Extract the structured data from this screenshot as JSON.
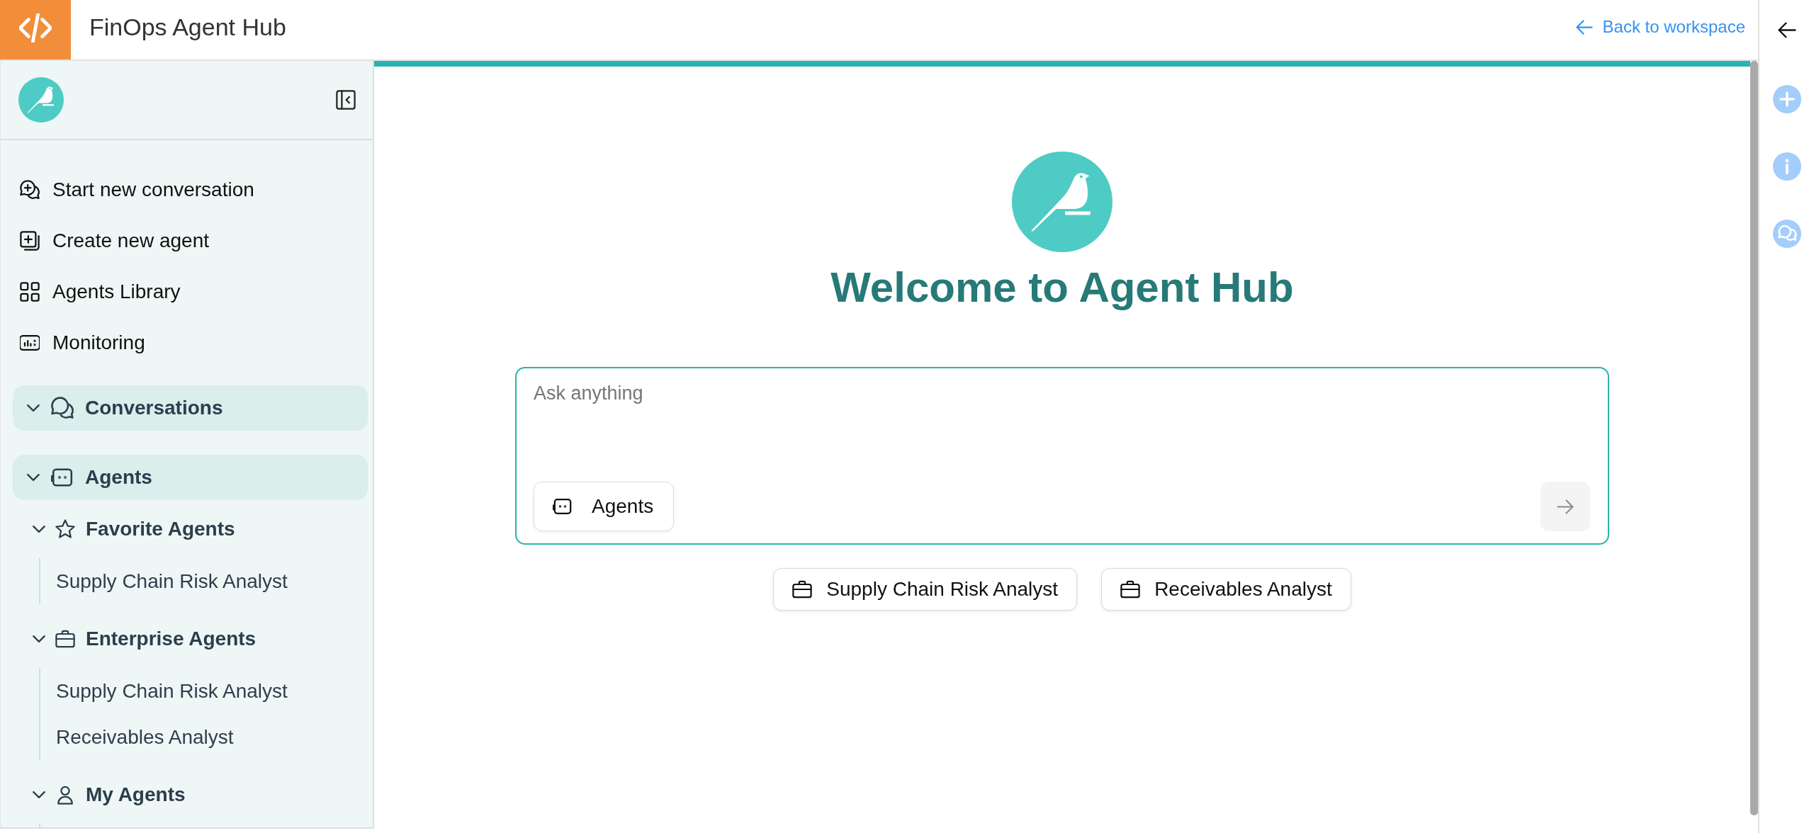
{
  "header": {
    "title": "FinOps Agent Hub",
    "back_link": "Back to workspace"
  },
  "sidebar": {
    "actions": [
      {
        "label": "Start new conversation",
        "kind": "chat-plus"
      },
      {
        "label": "Create new agent",
        "kind": "square-plus"
      },
      {
        "label": "Agents Library",
        "kind": "grid"
      },
      {
        "label": "Monitoring",
        "kind": "monitor"
      }
    ],
    "sections": [
      {
        "label": "Conversations",
        "kind": "chats",
        "expanded": true
      },
      {
        "label": "Agents",
        "kind": "robot",
        "expanded": true,
        "children": [
          {
            "label": "Favorite Agents",
            "kind": "star",
            "expanded": true,
            "children": [
              {
                "label": "Supply Chain Risk Analyst"
              }
            ]
          },
          {
            "label": "Enterprise Agents",
            "kind": "briefcase",
            "expanded": true,
            "children": [
              {
                "label": "Supply Chain Risk Analyst"
              },
              {
                "label": "Receivables Analyst"
              }
            ]
          },
          {
            "label": "My Agents",
            "kind": "person",
            "expanded": true
          }
        ]
      }
    ]
  },
  "main": {
    "title": "Welcome to Agent Hub",
    "prompt": {
      "placeholder": "Ask anything",
      "agents_button": "Agents",
      "send_disabled": true
    },
    "suggestions": [
      {
        "label": "Supply Chain Risk Analyst"
      },
      {
        "label": "Receivables Analyst"
      }
    ]
  }
}
